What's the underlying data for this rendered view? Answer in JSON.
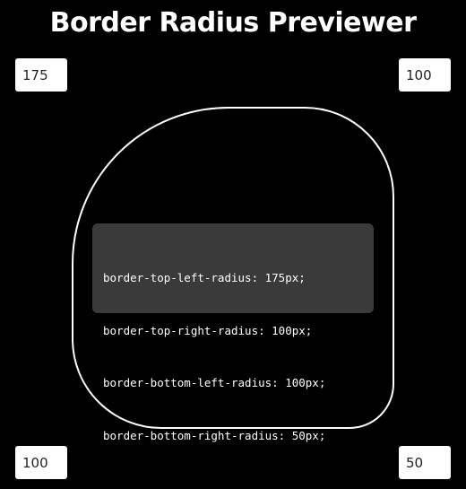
{
  "app": {
    "title": "Border Radius Previewer"
  },
  "inputs": {
    "top_left": "175",
    "top_right": "100",
    "bottom_left": "100",
    "bottom_right": "50"
  },
  "code": {
    "lines": [
      "border-top-left-radius: 175px;",
      "border-top-right-radius: 100px;",
      "border-bottom-left-radius: 100px;",
      "border-bottom-right-radius: 50px;"
    ]
  },
  "colors": {
    "background": "#000000",
    "preview_border": "#ffffff",
    "code_background": "#3a3a3a",
    "text": "#ffffff"
  }
}
